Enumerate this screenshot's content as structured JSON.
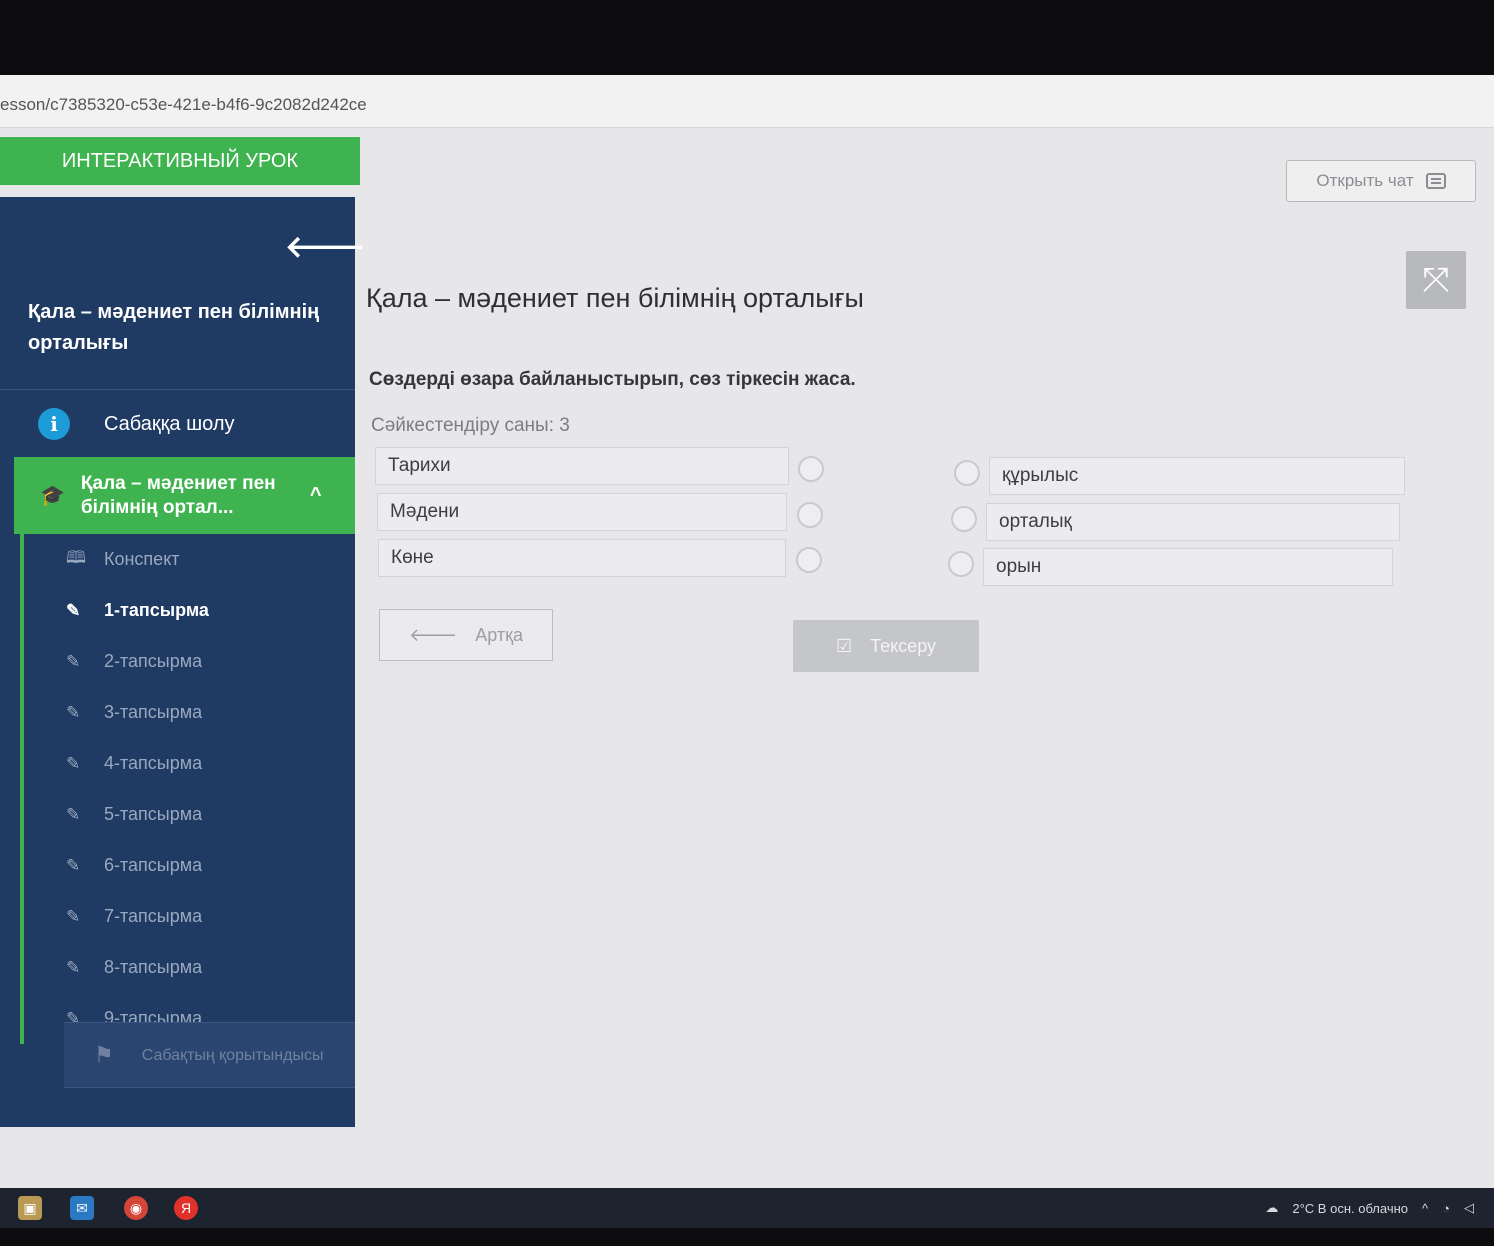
{
  "browser": {
    "url": "esson/c7385320-c53e-421e-b4f6-9c2082d242ce"
  },
  "header": {
    "brand": "ИНТЕРАКТИВНЫЙ УРОК",
    "open_chat": "Открыть чат"
  },
  "sidebar": {
    "title": "Қала – мәдениет пен білімнің орталығы",
    "overview": "Сабаққа шолу",
    "active_section": "Қала – мәдениет пен білімнің ортал...",
    "items": [
      {
        "label": "Конспект",
        "icon": "book-icon"
      },
      {
        "label": "1-тапсырма",
        "icon": "edit-icon"
      },
      {
        "label": "2-тапсырма",
        "icon": "edit-icon"
      },
      {
        "label": "3-тапсырма",
        "icon": "edit-icon"
      },
      {
        "label": "4-тапсырма",
        "icon": "edit-icon"
      },
      {
        "label": "5-тапсырма",
        "icon": "edit-icon"
      },
      {
        "label": "6-тапсырма",
        "icon": "edit-icon"
      },
      {
        "label": "7-тапсырма",
        "icon": "edit-icon"
      },
      {
        "label": "8-тапсырма",
        "icon": "edit-icon"
      },
      {
        "label": "9-тапсырма",
        "icon": "edit-icon"
      }
    ],
    "summary": "Сабақтың қорытындысы"
  },
  "main": {
    "title": "Қала – мәдениет пен білімнің орталығы",
    "instruction": "Сөздерді өзара байланыстырып, сөз тіркесін жаса.",
    "match_count": "Сәйкестендіру саны: 3",
    "left": [
      "Тарихи",
      "Мәдени",
      "Көне"
    ],
    "right": [
      "құрылыс",
      "орталық",
      "орын"
    ],
    "back_button": "Артқа",
    "check_button": "Тексеру"
  },
  "taskbar": {
    "weather": "2°C  В осн. облачно"
  },
  "colors": {
    "accent_green": "#3fb34f",
    "sidebar_navy": "#1f3a63"
  }
}
